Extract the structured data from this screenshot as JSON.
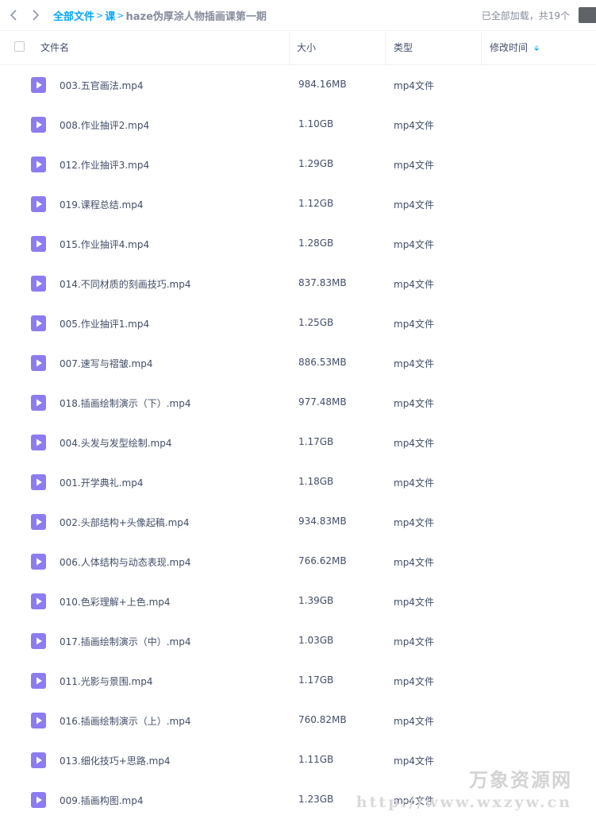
{
  "nav": {
    "back_label": "back",
    "forward_label": "forward"
  },
  "breadcrumb": {
    "root": "全部文件",
    "separator": "<",
    "parent": "课",
    "current": "haze伪厚涂人物插画课第一期"
  },
  "load_status": "已全部加载，共19个",
  "table": {
    "headers": {
      "name": "文件名",
      "size": "大小",
      "type": "类型",
      "modified": "修改时间"
    },
    "rows": [
      {
        "name": "003.五官画法.mp4",
        "size": "984.16MB",
        "type": "mp4文件"
      },
      {
        "name": "008.作业抽评2.mp4",
        "size": "1.10GB",
        "type": "mp4文件"
      },
      {
        "name": "012.作业抽评3.mp4",
        "size": "1.29GB",
        "type": "mp4文件"
      },
      {
        "name": "019.课程总结.mp4",
        "size": "1.12GB",
        "type": "mp4文件"
      },
      {
        "name": "015.作业抽评4.mp4",
        "size": "1.28GB",
        "type": "mp4文件"
      },
      {
        "name": "014.不同材质的刻画技巧.mp4",
        "size": "837.83MB",
        "type": "mp4文件"
      },
      {
        "name": "005.作业抽评1.mp4",
        "size": "1.25GB",
        "type": "mp4文件"
      },
      {
        "name": "007.速写与褶皱.mp4",
        "size": "886.53MB",
        "type": "mp4文件"
      },
      {
        "name": "018.插画绘制演示（下）.mp4",
        "size": "977.48MB",
        "type": "mp4文件"
      },
      {
        "name": "004.头发与发型绘制.mp4",
        "size": "1.17GB",
        "type": "mp4文件"
      },
      {
        "name": "001.开学典礼.mp4",
        "size": "1.18GB",
        "type": "mp4文件"
      },
      {
        "name": "002.头部结构+头像起稿.mp4",
        "size": "934.83MB",
        "type": "mp4文件"
      },
      {
        "name": "006.人体结构与动态表现.mp4",
        "size": "766.62MB",
        "type": "mp4文件"
      },
      {
        "name": "010.色彩理解+上色.mp4",
        "size": "1.39GB",
        "type": "mp4文件"
      },
      {
        "name": "017.插画绘制演示（中）.mp4",
        "size": "1.03GB",
        "type": "mp4文件"
      },
      {
        "name": "011.光影与景围.mp4",
        "size": "1.17GB",
        "type": "mp4文件"
      },
      {
        "name": "016.插画绘制演示（上）.mp4",
        "size": "760.82MB",
        "type": "mp4文件"
      },
      {
        "name": "013.细化技巧+思路.mp4",
        "size": "1.11GB",
        "type": "mp4文件"
      },
      {
        "name": "009.插画构图.mp4",
        "size": "1.23GB",
        "type": "mp4文件"
      }
    ]
  },
  "watermark": {
    "name": "万象资源网",
    "url": "http://www.wxzyw.cn"
  },
  "colors": {
    "accent": "#06a7ff",
    "video_icon": "#8c7cf0",
    "text": "#424e67",
    "muted": "#878c9c"
  }
}
